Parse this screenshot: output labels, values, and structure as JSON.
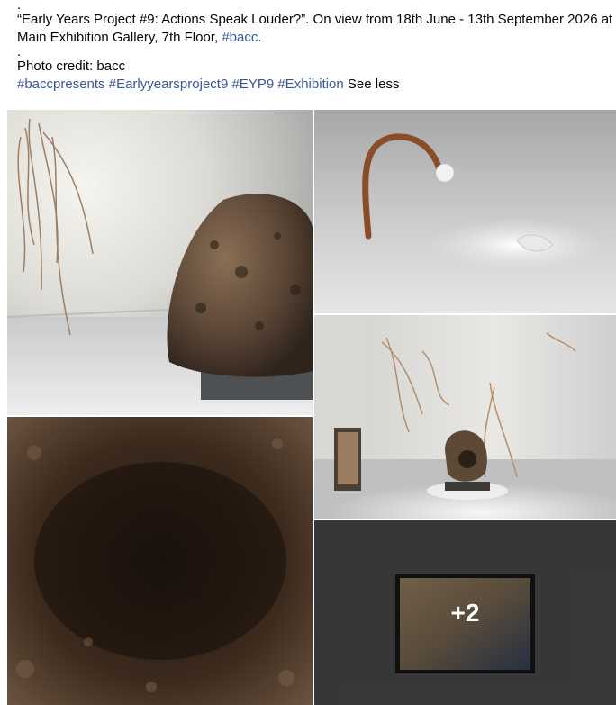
{
  "post": {
    "dot_top": ".",
    "caption_line1_a": "“Early Years Project #9: Actions Speak Louder?”. On view from 18th June - 13th September 2026 at",
    "caption_line2_a": "Main Exhibition Gallery, 7th Floor, ",
    "caption_line2_tag": "#bacc",
    "caption_line2_end": ".",
    "dot_mid": ".",
    "photo_credit": "Photo credit: bacc",
    "hashtags": [
      "#baccpresents",
      "#Earlyyearsproject9",
      "#EYP9",
      "#Exhibition"
    ],
    "see_less": "See less"
  },
  "gallery": {
    "more_count_label": "+2",
    "photos": [
      {
        "subject": "rock-sculpture-with-hanging-roots"
      },
      {
        "subject": "copper-pipe-with-glass-sculpture"
      },
      {
        "subject": "soil-closeup"
      },
      {
        "subject": "gallery-room-installation"
      },
      {
        "subject": "framed-screen-artwork"
      }
    ]
  },
  "colors": {
    "link": "#385898",
    "text": "#050505"
  }
}
